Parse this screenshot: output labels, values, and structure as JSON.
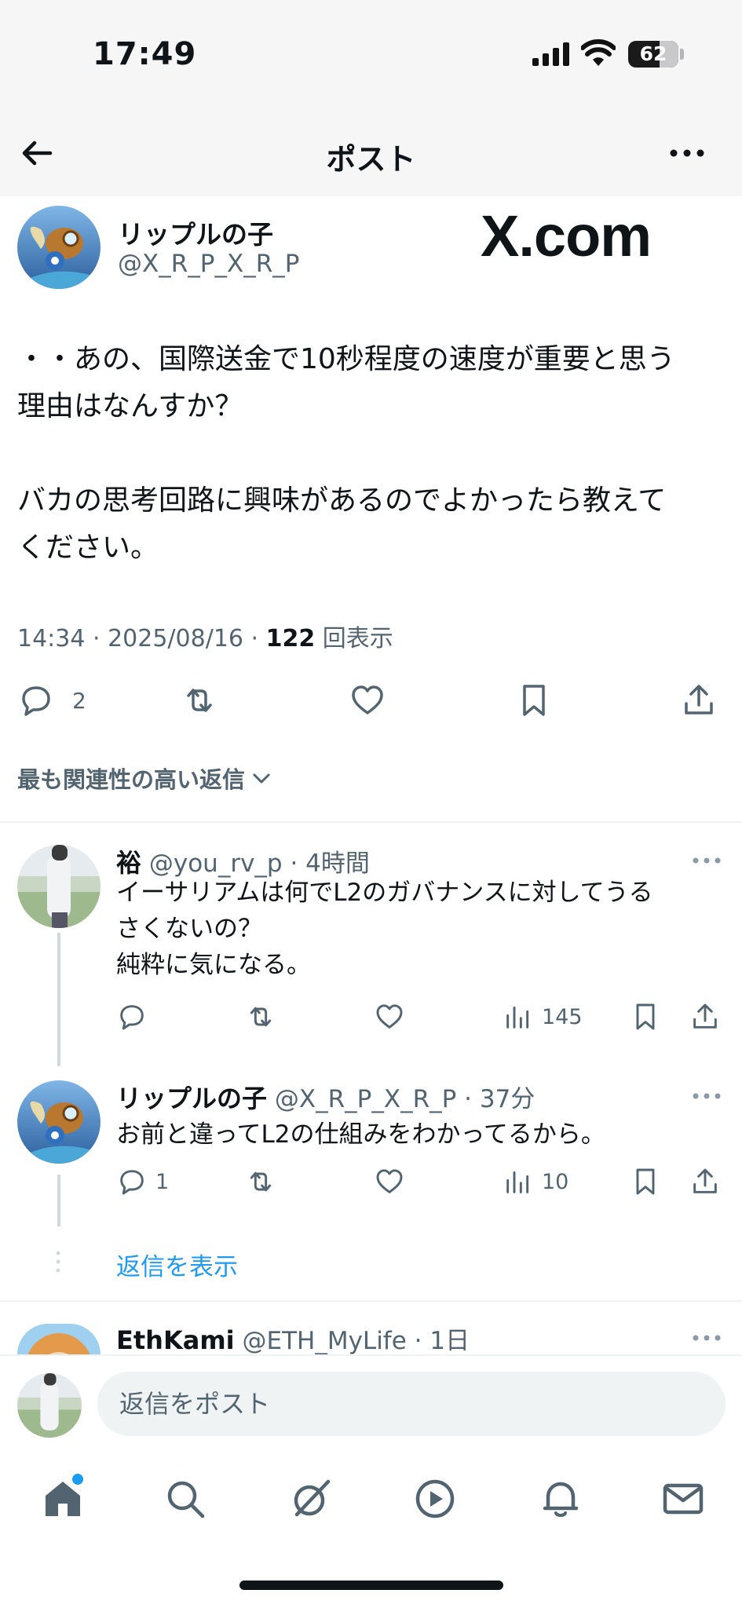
{
  "status_bar": {
    "time": "17:49",
    "battery": "62",
    "battery_level": 0.62
  },
  "header": {
    "title": "ポスト"
  },
  "watermark": "X.com",
  "post": {
    "author_name": "リップルの子",
    "author_handle": "@X_R_P_X_R_P",
    "body": [
      "・・あの、国際送金で10秒程度の速度が重要と思う",
      "理由はなんすか？",
      "",
      "バカの思考回路に興味があるのでよかったら教えて",
      "ください。"
    ],
    "time": "14:34",
    "date": "2025/08/16",
    "views": "122",
    "views_label": "回表示",
    "reply_count": "2"
  },
  "sort_label": "最も関連性の高い返信",
  "replies": [
    {
      "name": "裕",
      "handle": "@you_rv_p",
      "age": "4時間",
      "text": [
        "イーサリアムは何でL2のガバナンスに対してうる",
        "さくないの？",
        "純粋に気になる。"
      ],
      "reply_count": "",
      "views": "145"
    },
    {
      "name": "リップルの子",
      "handle": "@X_R_P_X_R_P",
      "age": "37分",
      "text": [
        "お前と違ってL2の仕組みをわかってるから。"
      ],
      "reply_count": "1",
      "views": "10"
    },
    {
      "name": "EthKami",
      "handle": "@ETH_MyLife",
      "age": "1日"
    }
  ],
  "show_replies": "返信を表示",
  "compose": {
    "placeholder": "返信をポスト"
  },
  "tabs": [
    "home-icon",
    "search-icon",
    "grok-icon",
    "video-icon",
    "notifications-icon",
    "messages-icon"
  ]
}
